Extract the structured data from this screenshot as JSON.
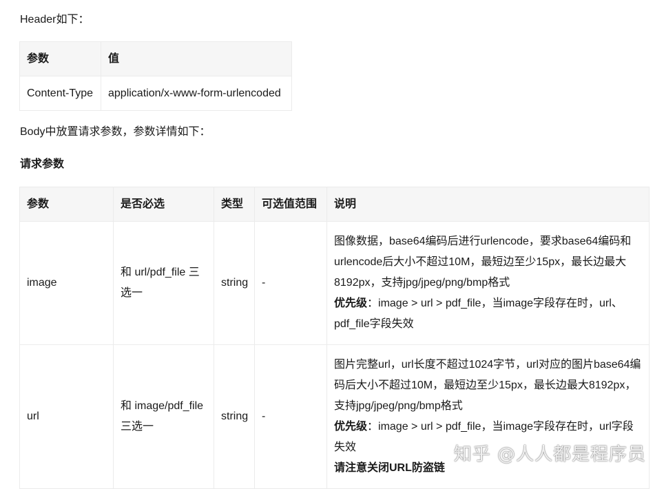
{
  "header_intro": "Header如下：",
  "header_table": {
    "columns": [
      "参数",
      "值"
    ],
    "rows": [
      [
        "Content-Type",
        "application/x-www-form-urlencoded"
      ]
    ]
  },
  "body_intro": "Body中放置请求参数，参数详情如下：",
  "request_params_title": "请求参数",
  "params_table": {
    "columns": [
      "参数",
      "是否必选",
      "类型",
      "可选值范围",
      "说明"
    ],
    "rows": [
      {
        "param": "image",
        "required": "和 url/pdf_file 三选一",
        "type": "string",
        "range": "-",
        "desc1": "图像数据，base64编码后进行urlencode，要求base64编码和urlencode后大小不超过10M，最短边至少15px，最长边最大8192px，支持jpg/jpeg/png/bmp格式",
        "priority_label": "优先级",
        "priority_text": "：image > url > pdf_file，当image字段存在时，url、pdf_file字段失效"
      },
      {
        "param": "url",
        "required": "和 image/pdf_file 三选一",
        "type": "string",
        "range": "-",
        "desc1": "图片完整url，url长度不超过1024字节，url对应的图片base64编码后大小不超过10M，最短边至少15px，最长边最大8192px，支持jpg/jpeg/png/bmp格式",
        "priority_label": "优先级",
        "priority_text": "：image > url > pdf_file，当image字段存在时，url字段失效",
        "note": "请注意关闭URL防盗链"
      }
    ]
  },
  "watermark": "知乎 @人人都是程序员"
}
